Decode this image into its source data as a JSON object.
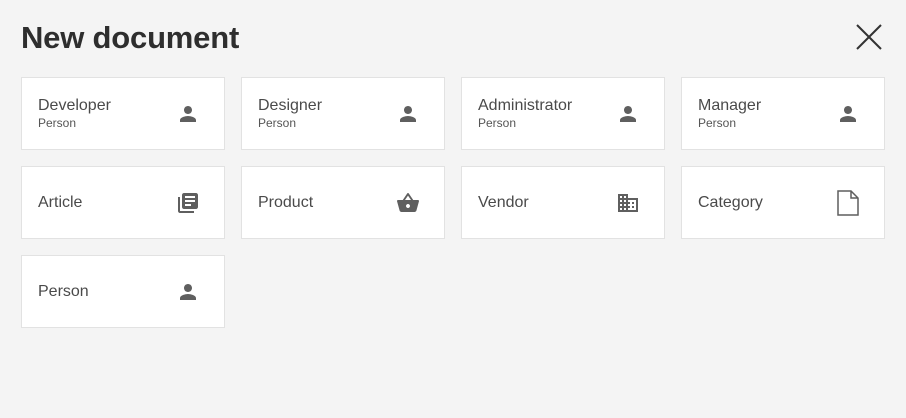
{
  "dialog": {
    "title": "New document",
    "close_icon": "close-icon"
  },
  "colors": {
    "background": "#f4f4f4",
    "tile_background": "#ffffff",
    "tile_border": "#e2e2e2",
    "icon": "#5f5f5f",
    "title": "#2e2e2e"
  },
  "tiles": [
    {
      "label": "Developer",
      "sub": "Person",
      "icon": "person-icon"
    },
    {
      "label": "Designer",
      "sub": "Person",
      "icon": "person-icon"
    },
    {
      "label": "Administrator",
      "sub": "Person",
      "icon": "person-icon"
    },
    {
      "label": "Manager",
      "sub": "Person",
      "icon": "person-icon"
    },
    {
      "label": "Article",
      "icon": "library-books-icon"
    },
    {
      "label": "Product",
      "icon": "shopping-basket-icon"
    },
    {
      "label": "Vendor",
      "icon": "building-icon"
    },
    {
      "label": "Category",
      "icon": "document-icon"
    },
    {
      "label": "Person",
      "icon": "person-icon"
    }
  ]
}
